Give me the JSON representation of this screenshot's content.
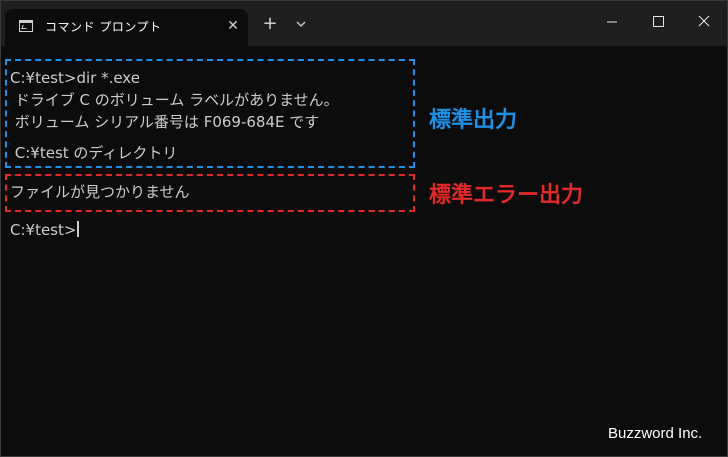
{
  "tab": {
    "title": "コマンド プロンプト",
    "icon": "terminal-icon",
    "close_icon": "close-icon"
  },
  "titlebar": {
    "new_tab_label": "+",
    "dropdown_icon": "chevron-down-icon",
    "minimize_icon": "minimize-icon",
    "maximize_icon": "maximize-icon",
    "close_icon": "close-icon"
  },
  "console": {
    "lines": [
      "C:¥test>dir *.exe",
      " ドライブ C のボリューム ラベルがありません。",
      " ボリューム シリアル番号は F069-684E です",
      "",
      " C:¥test のディレクトリ",
      "ファイルが見つかりません",
      "C:¥test>"
    ]
  },
  "annotations": {
    "stdout_label": "標準出力",
    "stderr_label": "標準エラー出力",
    "stdout_color": "#1e90e6",
    "stderr_color": "#e02a2a"
  },
  "watermark": "Buzzword Inc."
}
